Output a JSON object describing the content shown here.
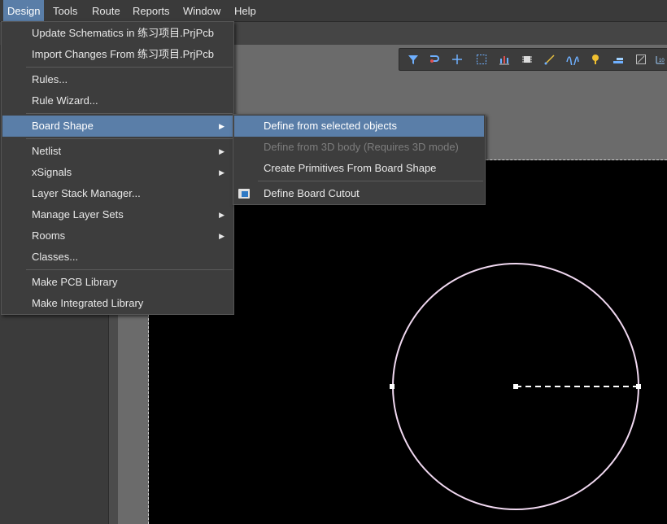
{
  "menubar": {
    "items": [
      {
        "label": "Design",
        "key": "D",
        "active": true
      },
      {
        "label": "Tools",
        "key": "T"
      },
      {
        "label": "Route",
        "key": "u"
      },
      {
        "label": "Reports",
        "key": "R"
      },
      {
        "label": "Window",
        "key": "W"
      },
      {
        "label": "Help",
        "key": "H"
      }
    ]
  },
  "design_menu": {
    "items": [
      "Update Schematics in 练习项目.PrjPcb",
      "Import Changes From 练习项目.PrjPcb",
      "Rules...",
      "Rule Wizard...",
      "Board Shape",
      "Netlist",
      "xSignals",
      "Layer Stack Manager...",
      "Manage Layer Sets",
      "Rooms",
      "Classes...",
      "Make PCB Library",
      "Make Integrated Library"
    ]
  },
  "board_shape_submenu": {
    "items": [
      "Define from selected objects",
      "Define from 3D body (Requires 3D mode)",
      "Create Primitives From Board Shape",
      "Define Board Cutout"
    ]
  },
  "toolbar": {
    "icons": [
      "filter-icon",
      "route-icon",
      "crosshair-icon",
      "select-rect-icon",
      "chart-icon",
      "component-icon",
      "route-wire-icon",
      "wave-icon",
      "probe-icon",
      "layer-icon",
      "measure-icon",
      "dimension-icon"
    ]
  },
  "colors": {
    "highlight": "#5a7ea8",
    "canvas": "#000000",
    "circle": "#f0d8f0"
  }
}
